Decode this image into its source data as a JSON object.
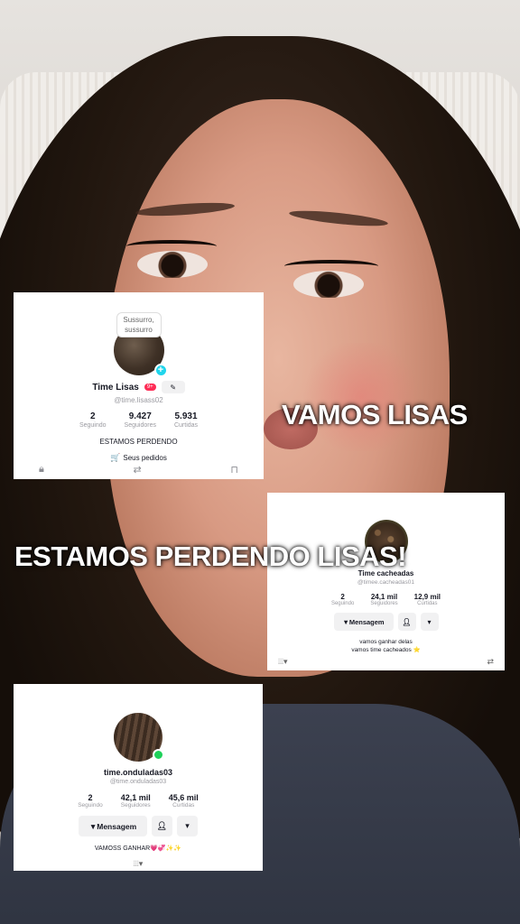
{
  "captions": {
    "vamos": "VAMOS LISAS",
    "estamos": "ESTAMOS PERDENDO LISAS!"
  },
  "card_lisas": {
    "tooltip": "Sussurro, sussurro",
    "name": "Time Lisas",
    "badge": "9+",
    "handle": "@time.lisass02",
    "stats": [
      {
        "value": "2",
        "label": "Seguindo"
      },
      {
        "value": "9.427",
        "label": "Seguidores"
      },
      {
        "value": "5.931",
        "label": "Curtidas"
      }
    ],
    "bio": "ESTAMOS PERDENDO",
    "orders": "Seus pedidos",
    "icons": [
      "lock-icon",
      "repost-icon",
      "bookmark-icon"
    ]
  },
  "card_cacheadas": {
    "name": "Time cacheadas",
    "handle": "@timee.cacheadas01",
    "stats": [
      {
        "value": "2",
        "label": "Seguindo"
      },
      {
        "value": "24,1 mil",
        "label": "Seguidores"
      },
      {
        "value": "12,9 mil",
        "label": "Curtidas"
      }
    ],
    "message": "Mensagem",
    "bio_line1": "vamos ganhar delas",
    "bio_line2": "vamos time cacheados ⭐"
  },
  "card_onduladas": {
    "name": "time.onduladas03",
    "handle": "@time.onduladas03",
    "stats": [
      {
        "value": "2",
        "label": "Seguindo"
      },
      {
        "value": "42,1 mil",
        "label": "Seguidores"
      },
      {
        "value": "45,6 mil",
        "label": "Curtidas"
      }
    ],
    "message": "Mensagem",
    "bio": "VAMOSS GANHAR💗💞✨✨"
  },
  "colors": {
    "accent_red": "#fe2c55",
    "accent_cyan": "#20d5ec",
    "online_green": "#1fd15a"
  }
}
